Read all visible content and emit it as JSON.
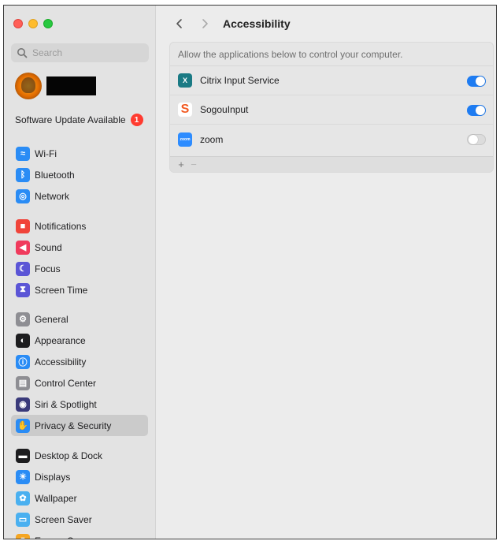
{
  "window": {
    "traffic_lights": [
      "close",
      "minimize",
      "zoom"
    ]
  },
  "sidebar": {
    "search_placeholder": "Search",
    "update_label": "Software Update Available",
    "update_count": "1",
    "groups": [
      [
        {
          "label": "Wi-Fi",
          "icon": "wifi-icon",
          "color": "#2a8cf5"
        },
        {
          "label": "Bluetooth",
          "icon": "bluetooth-icon",
          "color": "#2a8cf5"
        },
        {
          "label": "Network",
          "icon": "globe-icon",
          "color": "#2a8cf5"
        }
      ],
      [
        {
          "label": "Notifications",
          "icon": "bell-icon",
          "color": "#f0443a"
        },
        {
          "label": "Sound",
          "icon": "speaker-icon",
          "color": "#f03a5c"
        },
        {
          "label": "Focus",
          "icon": "moon-icon",
          "color": "#5b55d6"
        },
        {
          "label": "Screen Time",
          "icon": "hourglass-icon",
          "color": "#5b55d6"
        }
      ],
      [
        {
          "label": "General",
          "icon": "gear-icon",
          "color": "#8e8e93"
        },
        {
          "label": "Appearance",
          "icon": "appearance-icon",
          "color": "#1d1d1f"
        },
        {
          "label": "Accessibility",
          "icon": "accessibility-icon",
          "color": "#2a8cf5"
        },
        {
          "label": "Control Center",
          "icon": "control-center-icon",
          "color": "#8e8e93"
        },
        {
          "label": "Siri & Spotlight",
          "icon": "siri-icon",
          "color": "#3a3a7a"
        },
        {
          "label": "Privacy & Security",
          "icon": "hand-icon",
          "color": "#2a8cf5",
          "selected": true
        }
      ],
      [
        {
          "label": "Desktop & Dock",
          "icon": "dock-icon",
          "color": "#1d1d1f"
        },
        {
          "label": "Displays",
          "icon": "sun-icon",
          "color": "#2a8cf5"
        },
        {
          "label": "Wallpaper",
          "icon": "wallpaper-icon",
          "color": "#4ab0f0"
        },
        {
          "label": "Screen Saver",
          "icon": "screensaver-icon",
          "color": "#4ab0f0"
        },
        {
          "label": "Energy Saver",
          "icon": "battery-icon",
          "color": "#f5a623"
        }
      ]
    ]
  },
  "main": {
    "title": "Accessibility",
    "panel_header": "Allow the applications below to control your computer.",
    "apps": [
      {
        "name": "Citrix Input Service",
        "icon": "citrix-icon",
        "icon_text": "X",
        "color": "#1a7a84",
        "enabled": true
      },
      {
        "name": "SogouInput",
        "icon": "sogou-icon",
        "icon_text": "S",
        "color": "#f25a22",
        "enabled": true
      },
      {
        "name": "zoom",
        "icon": "zoom-icon",
        "icon_text": "zoom",
        "color": "#2d8cff",
        "enabled": false
      }
    ],
    "footer_add": "+",
    "footer_remove": "−"
  }
}
